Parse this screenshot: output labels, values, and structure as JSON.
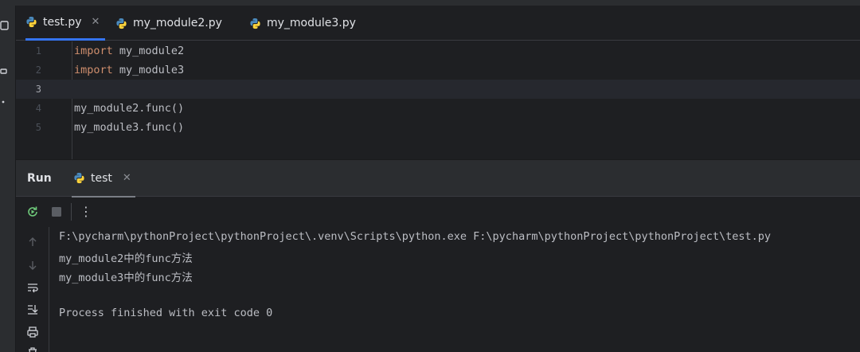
{
  "editor_tabs": [
    {
      "label": "test.py",
      "active": true,
      "close": "✕"
    },
    {
      "label": "my_module2.py",
      "active": false
    },
    {
      "label": "my_module3.py",
      "active": false
    }
  ],
  "code_lines": [
    {
      "num": "1",
      "keyword": "import",
      "rest": " my_module2"
    },
    {
      "num": "2",
      "keyword": "import",
      "rest": " my_module3"
    },
    {
      "num": "3",
      "keyword": "",
      "rest": ""
    },
    {
      "num": "4",
      "keyword": "",
      "rest": "my_module2.func()"
    },
    {
      "num": "5",
      "keyword": "",
      "rest": "my_module3.func()"
    }
  ],
  "run_panel": {
    "title": "Run",
    "tab_label": "test",
    "tab_close": "✕",
    "more_icon": "⋮"
  },
  "console_output": [
    "F:\\pycharm\\pythonProject\\pythonProject\\.venv\\Scripts\\python.exe F:\\pycharm\\pythonProject\\pythonProject\\test.py",
    "my_module2中的func方法",
    "my_module3中的func方法",
    "",
    "Process finished with exit code 0"
  ],
  "colors": {
    "accent": "#3574f0",
    "keyword": "#cf8e6d",
    "background": "#1e1f22",
    "panel": "#2b2d30"
  }
}
